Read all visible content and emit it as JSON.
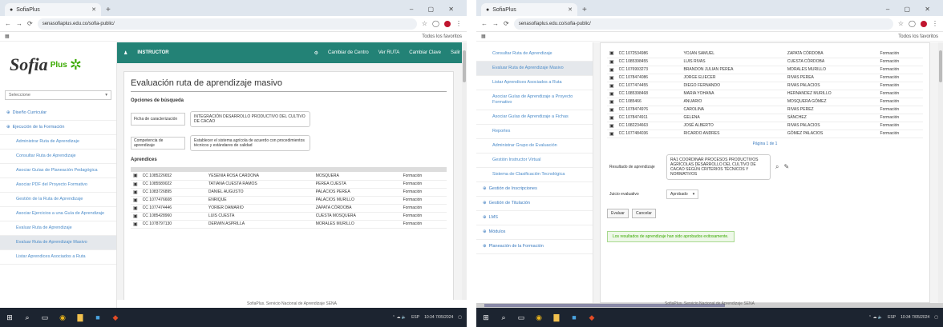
{
  "left": {
    "tab_title": "SofiaPlus",
    "url": "senasofiaplus.edu.co/sofia-public/",
    "bookmarks_right": "Todos los favoritos",
    "logo": {
      "sofia": "Sofia",
      "plus": "Plus"
    },
    "select_placeholder": "Seleccione",
    "nav": [
      {
        "label": "Diseño Curricular",
        "kind": "top"
      },
      {
        "label": "Ejecución de la Formación",
        "kind": "top"
      },
      {
        "label": "Administrar Ruta de Aprendizaje",
        "kind": "sub"
      },
      {
        "label": "Consultar Ruta de Aprendizaje",
        "kind": "sub"
      },
      {
        "label": "Asociar Guías de Planeación Pedagógica",
        "kind": "sub"
      },
      {
        "label": "Asociar PDF del Proyecto Formativo",
        "kind": "sub"
      },
      {
        "label": "Gestión de la Ruta de Aprendizaje",
        "kind": "sub"
      },
      {
        "label": "Asociar Ejercicios a una Guía de Aprendizaje",
        "kind": "sub"
      },
      {
        "label": "Evaluar Ruta de Aprendizaje",
        "kind": "sub"
      },
      {
        "label": "Evaluar Ruta de Aprendizaje Masivo",
        "kind": "sub",
        "active": true
      },
      {
        "label": "Listar Aprendices Asociados a Ruta",
        "kind": "sub"
      }
    ],
    "topbar": {
      "role": "INSTRUCTOR",
      "items": [
        "Cambiar de Centro",
        "Ver RUTA",
        "Cambiar Clave",
        "Salir"
      ]
    },
    "card_title": "Evaluación ruta de aprendizaje masivo",
    "section_criteria": "Opciones de búsqueda",
    "field1_label": "Ficha de caracterización",
    "field1_value": "INTEGRACIÓN DESARROLLO PRODUCTIVO DEL CULTIVO DE CACAO",
    "field2_label": "Competencia de aprendizaje",
    "field2_value": "Establecer el sistema agrícola de acuerdo con procedimientos técnicos y estándares de calidad",
    "section_learners": "Aprendices",
    "rows": [
      {
        "doc": "CC 1085226652",
        "name": "YESENIA ROSA CARDONA",
        "last": "MOSQUERA",
        "status": "Formación"
      },
      {
        "doc": "CC 1085589022",
        "name": "TATIANA CUESTA RAMOS",
        "last": "PEREA CUESTA",
        "status": "Formación"
      },
      {
        "doc": "CC 1083726895",
        "name": "DANIEL AUGUSTO",
        "last": "PALACIOS PEREA",
        "status": "Formación"
      },
      {
        "doc": "CC 1077476608",
        "name": "ENRIQUE",
        "last": "PALACIOS MURILLO",
        "status": "Formación"
      },
      {
        "doc": "CC 1077474446",
        "name": "YORIER DAMARIO",
        "last": "ZAPATA CÓRDOBA",
        "status": "Formación"
      },
      {
        "doc": "CC 1085428960",
        "name": "LUIS CUESTA",
        "last": "CUESTA MOSQUERA",
        "status": "Formación"
      },
      {
        "doc": "CC 1078797130",
        "name": "DERWIN ASPRILLA",
        "last": "MORALES MURILLO",
        "status": "Formación"
      }
    ],
    "footer": "SofiaPlus. Servicio Nacional de Aprendizaje SENA"
  },
  "right": {
    "tab_title": "SofiaPlus",
    "url": "senasofiaplus.edu.co/sofia-public/",
    "bookmarks_right": "Todos los favoritos",
    "nav": [
      {
        "label": "Consultar Ruta de Aprendizaje",
        "kind": "sub"
      },
      {
        "label": "Evaluar Ruta de Aprendizaje Masivo",
        "kind": "sub",
        "active": true
      },
      {
        "label": "Listar Aprendices Asociados a Ruta",
        "kind": "sub"
      },
      {
        "label": "Asociar Guías de Aprendizaje a Proyecto Formativo",
        "kind": "sub"
      },
      {
        "label": "Asociar Guías de Aprendizaje a Fichas",
        "kind": "sub"
      },
      {
        "label": "Reportes",
        "kind": "sub"
      },
      {
        "label": "Administrar Grupo de Evaluación",
        "kind": "sub"
      },
      {
        "label": "Gestión Instructor Virtual",
        "kind": "sub"
      },
      {
        "label": "Sistema de Clasificación Tecnológica",
        "kind": "sub"
      },
      {
        "label": "Gestión de Inscripciones",
        "kind": "top"
      },
      {
        "label": "Gestión de Titulación",
        "kind": "top"
      },
      {
        "label": "LMS",
        "kind": "top"
      },
      {
        "label": "Módulos",
        "kind": "top"
      },
      {
        "label": "Planeación de la Formación",
        "kind": "top"
      }
    ],
    "rows": [
      {
        "doc": "CC 1072534986",
        "name": "YOJAN SAMUEL",
        "last": "ZAPATA CÓRDOBA",
        "status": "Formación"
      },
      {
        "doc": "CC 1085398455",
        "name": "LUIS RIVAS",
        "last": "CUESTA CÓRDOBA",
        "status": "Formación"
      },
      {
        "doc": "CC 1076993273",
        "name": "BRANDON JULIAN PEREA",
        "last": "MORALES MURILLO",
        "status": "Formación"
      },
      {
        "doc": "CC 1078474086",
        "name": "JORGE ELIECER",
        "last": "RIVAS PEREA",
        "status": "Formación"
      },
      {
        "doc": "CC 1077474455",
        "name": "DIEGO FERNANDO",
        "last": "RIVAS PALACIOS",
        "status": "Formación"
      },
      {
        "doc": "CC 1085398468",
        "name": "MARIA YOHANA",
        "last": "HERNANDEZ MURILLO",
        "status": "Formación"
      },
      {
        "doc": "CC 1085466",
        "name": "ANUARIO",
        "last": "MOSQUERA GÓMEZ",
        "status": "Formación"
      },
      {
        "doc": "CC 1078474976",
        "name": "CAROLINA",
        "last": "RIVAS PEREZ",
        "status": "Formación"
      },
      {
        "doc": "CC 1078474911",
        "name": "GELENA",
        "last": "SÁNCHEZ",
        "status": "Formación"
      },
      {
        "doc": "CC 1082234663",
        "name": "JOSÉ ALBERTO",
        "last": "RIVAS PALACIOS",
        "status": "Formación"
      },
      {
        "doc": "CC 1077484036",
        "name": "RICARDO ANDRES",
        "last": "GÓMEZ PALACIOS",
        "status": "Formación"
      }
    ],
    "paging": "Página 1 de 1",
    "result_label": "Resultado de aprendizaje",
    "result_value": "RA1 COORDINAR PROCESOS PRODUCTIVOS AGRÍCOLAS DESARROLLO DEL CULTIVO DE CACAO SEGÚN CRITERIOS TÉCNICOS Y NORMATIVOS",
    "eval_label": "Juicio evaluativo",
    "eval_value": "Aprobado",
    "btn_evaluate": "Evaluar",
    "btn_cancel": "Cancelar",
    "message": "Los resultados de aprendizaje han sido aprobados exitosamente.",
    "footer": "SofiaPlus. Servicio Nacional de Aprendizaje SENA"
  },
  "taskbar": {
    "time": "10:34",
    "date": "7/05/2024",
    "lang": "ESP"
  }
}
